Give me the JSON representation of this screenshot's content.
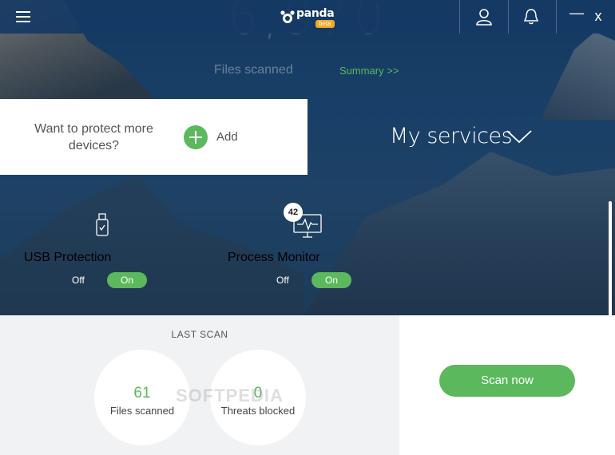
{
  "titlebar": {
    "brand": "panda",
    "beta_badge": "beta",
    "icons": [
      "menu-icon",
      "user-icon",
      "bell-icon",
      "minimize-icon",
      "close-icon"
    ],
    "minimize_label": "—",
    "close_label": "x"
  },
  "top_stats": {
    "big_number": "6,970",
    "files_scanned_label": "Files scanned",
    "summary_link": "Summary >>"
  },
  "protect_card": {
    "text": "Want to protect more devices?",
    "add_label": "Add"
  },
  "services": {
    "title": "My services",
    "items": [
      {
        "label": "USB Protection",
        "off_label": "Off",
        "on_label": "On",
        "icon": "usb-icon",
        "state": "on"
      },
      {
        "label": "Process Monitor",
        "off_label": "Off",
        "on_label": "On",
        "icon": "monitor-icon",
        "state": "on",
        "badge": "42"
      }
    ]
  },
  "last_scan": {
    "title": "LAST SCAN",
    "files_scanned_value": "61",
    "files_scanned_label": "Files scanned",
    "threats_blocked_value": "0",
    "threats_blocked_label": "Threats blocked"
  },
  "scan_now_label": "Scan now",
  "watermark": "SOFTPEDIA",
  "colors": {
    "accent_green": "#5cb85c",
    "titlebar": "#153964",
    "beta": "#f5a623"
  }
}
